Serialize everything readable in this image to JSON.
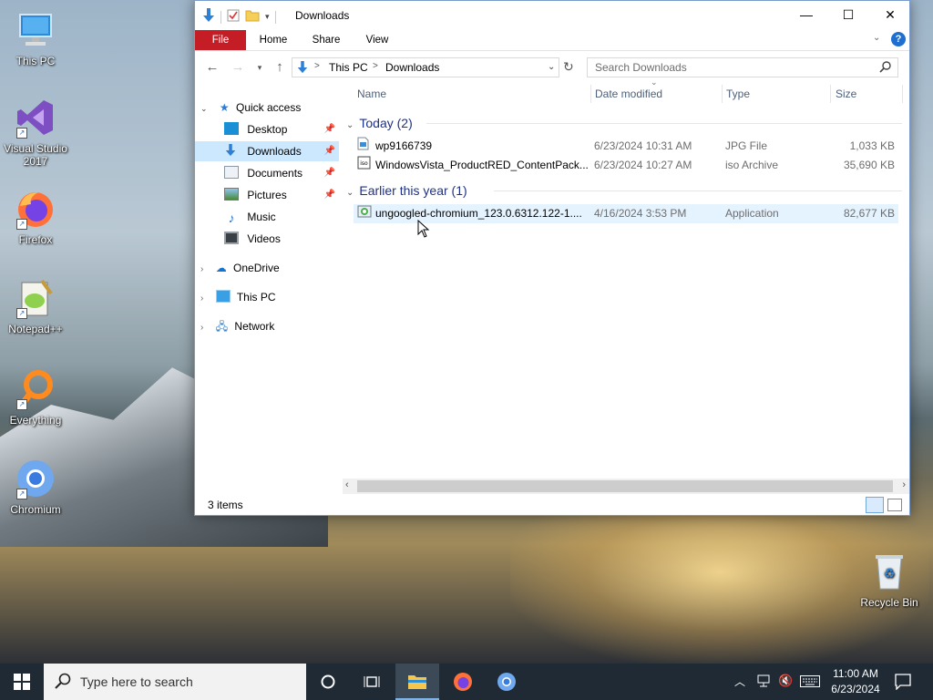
{
  "desktop": {
    "icons": [
      {
        "label": "This PC"
      },
      {
        "label": "Visual Studio 2017"
      },
      {
        "label": "Firefox"
      },
      {
        "label": "Notepad++"
      },
      {
        "label": "Everything"
      },
      {
        "label": "Chromium"
      },
      {
        "label": "Recycle Bin"
      }
    ]
  },
  "window": {
    "title": "Downloads",
    "controls": {
      "minimize": "—",
      "maximize": "☐",
      "close": "✕"
    },
    "ribbon": {
      "tabs": [
        "File",
        "Home",
        "Share",
        "View"
      ],
      "help": "?"
    },
    "address": {
      "segments": [
        "This PC",
        "Downloads"
      ],
      "separator": ">"
    },
    "search": {
      "placeholder": "Search Downloads"
    },
    "nav": {
      "quick_access": "Quick access",
      "items": [
        "Desktop",
        "Downloads",
        "Documents",
        "Pictures",
        "Music",
        "Videos"
      ],
      "onedrive": "OneDrive",
      "this_pc": "This PC",
      "network": "Network"
    },
    "columns": {
      "name": "Name",
      "date": "Date modified",
      "type": "Type",
      "size": "Size"
    },
    "groups": [
      {
        "title": "Today (2)",
        "files": [
          {
            "name": "wp9166739",
            "date": "6/23/2024 10:31 AM",
            "type": "JPG File",
            "size": "1,033 KB"
          },
          {
            "name": "WindowsVista_ProductRED_ContentPack...",
            "date": "6/23/2024 10:27 AM",
            "type": "iso Archive",
            "size": "35,690 KB"
          }
        ]
      },
      {
        "title": "Earlier this year (1)",
        "files": [
          {
            "name": "ungoogled-chromium_123.0.6312.122-1....",
            "date": "4/16/2024 3:53 PM",
            "type": "Application",
            "size": "82,677 KB"
          }
        ]
      }
    ],
    "status": "3 items"
  },
  "taskbar": {
    "search_placeholder": "Type here to search",
    "time": "11:00 AM",
    "date": "6/23/2024"
  },
  "colors": {
    "file_tab": "#c51d25",
    "selection": "#cce8ff",
    "hover_row": "#e5f3ff",
    "group_title": "#1e3287",
    "taskbar": "#1f2a34"
  }
}
